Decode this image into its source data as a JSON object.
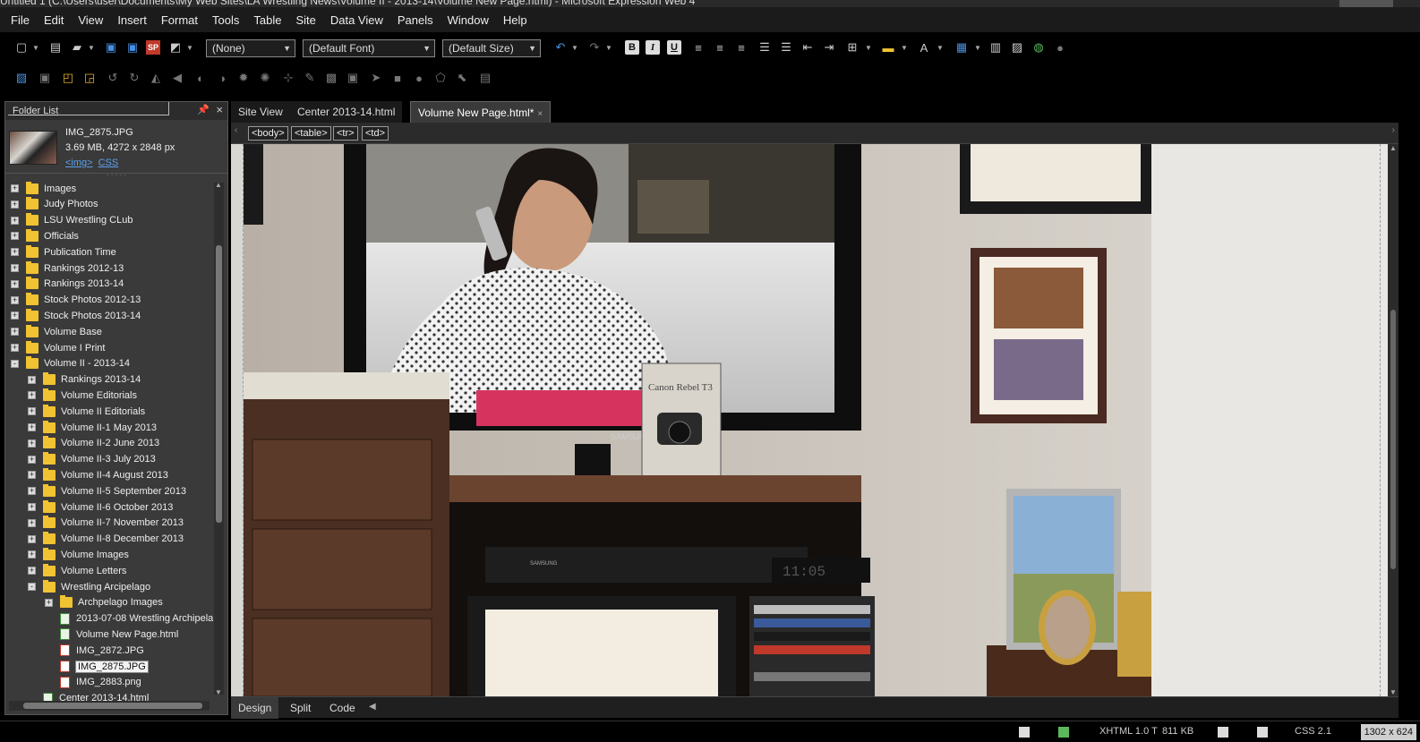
{
  "window": {
    "title": "Untitled 1 (C:\\Users\\user\\Documents\\My Web Sites\\LA Wrestling News\\Volume II - 2013-14\\Volume New Page.html) - Microsoft Expression Web 4"
  },
  "menu": [
    "File",
    "Edit",
    "View",
    "Insert",
    "Format",
    "Tools",
    "Table",
    "Site",
    "Data View",
    "Panels",
    "Window",
    "Help"
  ],
  "toolbar": {
    "style_select": "(None)",
    "font_select": "(Default Font)",
    "size_select": "(Default Size)",
    "bold": "B",
    "italic": "I",
    "underline": "U"
  },
  "folder_list": {
    "title": "Folder List",
    "preview": {
      "filename": "IMG_2875.JPG",
      "info": "3.69 MB, 4272 x 2848 px",
      "link_img": "<img>",
      "link_css": "CSS"
    },
    "items": [
      {
        "label": "Images",
        "type": "folder",
        "level": 0,
        "state": "+"
      },
      {
        "label": "Judy Photos",
        "type": "folder",
        "level": 0,
        "state": "+"
      },
      {
        "label": "LSU Wrestling CLub",
        "type": "folder",
        "level": 0,
        "state": "+"
      },
      {
        "label": "Officials",
        "type": "folder",
        "level": 0,
        "state": "+"
      },
      {
        "label": "Publication Time",
        "type": "folder",
        "level": 0,
        "state": "+"
      },
      {
        "label": "Rankings 2012-13",
        "type": "folder",
        "level": 0,
        "state": "+"
      },
      {
        "label": "Rankings 2013-14",
        "type": "folder",
        "level": 0,
        "state": "+"
      },
      {
        "label": "Stock Photos 2012-13",
        "type": "folder",
        "level": 0,
        "state": "+"
      },
      {
        "label": "Stock Photos 2013-14",
        "type": "folder",
        "level": 0,
        "state": "+"
      },
      {
        "label": "Volume Base",
        "type": "folder",
        "level": 0,
        "state": "+"
      },
      {
        "label": "Volume I Print",
        "type": "folder",
        "level": 0,
        "state": "+"
      },
      {
        "label": "Volume II - 2013-14",
        "type": "folder",
        "level": 0,
        "state": "-"
      },
      {
        "label": "Rankings 2013-14",
        "type": "folder",
        "level": 1,
        "state": "+"
      },
      {
        "label": "Volume Editorials",
        "type": "folder",
        "level": 1,
        "state": "+"
      },
      {
        "label": "Volume II Editorials",
        "type": "folder",
        "level": 1,
        "state": "+"
      },
      {
        "label": "Volume II-1 May 2013",
        "type": "folder",
        "level": 1,
        "state": "+"
      },
      {
        "label": "Volume II-2 June 2013",
        "type": "folder",
        "level": 1,
        "state": "+"
      },
      {
        "label": "Volume II-3 July 2013",
        "type": "folder",
        "level": 1,
        "state": "+"
      },
      {
        "label": "Volume II-4 August 2013",
        "type": "folder",
        "level": 1,
        "state": "+"
      },
      {
        "label": "Volume II-5 September 2013",
        "type": "folder",
        "level": 1,
        "state": "+"
      },
      {
        "label": "Volume II-6 October 2013",
        "type": "folder",
        "level": 1,
        "state": "+"
      },
      {
        "label": "Volume II-7 November 2013",
        "type": "folder",
        "level": 1,
        "state": "+"
      },
      {
        "label": "Volume II-8 December 2013",
        "type": "folder",
        "level": 1,
        "state": "+"
      },
      {
        "label": "Volume Images",
        "type": "folder",
        "level": 1,
        "state": "+"
      },
      {
        "label": "Volume Letters",
        "type": "folder",
        "level": 1,
        "state": "+"
      },
      {
        "label": "Wrestling Arcipelago",
        "type": "folder",
        "level": 1,
        "state": "-"
      },
      {
        "label": "Archpelago Images",
        "type": "folder",
        "level": 2,
        "state": "+"
      },
      {
        "label": "2013-07-08 Wrestling Archipela",
        "type": "html",
        "level": 2,
        "state": ""
      },
      {
        "label": "Volume New Page.html",
        "type": "html",
        "level": 2,
        "state": ""
      },
      {
        "label": "IMG_2872.JPG",
        "type": "jpg",
        "level": 2,
        "state": ""
      },
      {
        "label": "IMG_2875.JPG",
        "type": "jpg",
        "level": 2,
        "state": "",
        "selected": true
      },
      {
        "label": "IMG_2883.png",
        "type": "jpg",
        "level": 2,
        "state": ""
      },
      {
        "label": "Center 2013-14.html",
        "type": "html",
        "level": 1,
        "state": ""
      }
    ]
  },
  "doc_tabs": [
    {
      "label": "Site View"
    },
    {
      "label": "Center 2013-14.html"
    },
    {
      "label": "Volume New Page.html*",
      "active": true,
      "close": "×"
    }
  ],
  "tag_selector": [
    "<body>",
    "<table>",
    "<tr>",
    "<td>"
  ],
  "photo": {
    "tv_brand": "SAMSUNG",
    "dvd_brand": "SAMSUNG",
    "box_text": "Canon Rebel T3",
    "clock": "11:05"
  },
  "view_tabs": [
    {
      "label": "Design",
      "active": true
    },
    {
      "label": "Split"
    },
    {
      "label": "Code"
    }
  ],
  "status": {
    "doctype": "XHTML 1.0 T",
    "filesize": "811 KB",
    "css": "CSS 2.1",
    "dimensions": "1302 x 624"
  }
}
